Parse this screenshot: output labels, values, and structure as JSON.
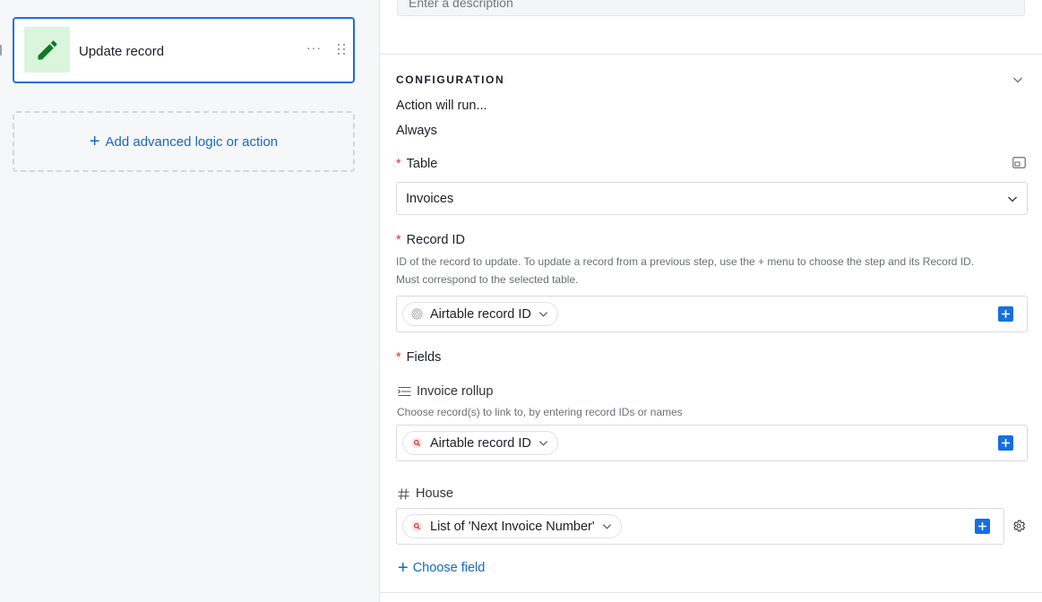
{
  "step_card": {
    "title": "Update record",
    "more_label": "···"
  },
  "add_logic": {
    "plus": "+",
    "label": "Add advanced logic or action"
  },
  "description": {
    "placeholder": "Enter a description"
  },
  "configuration": {
    "section_title": "CONFIGURATION",
    "action_runs_label": "Action will run...",
    "action_runs_value": "Always",
    "required_mark": "*",
    "table": {
      "label": "Table",
      "value": "Invoices"
    },
    "record_id": {
      "label": "Record ID",
      "help_line1": "ID of the record to update. To update a record from a previous step, use the + menu to choose the step and its Record ID.",
      "help_line2": "Must correspond to the selected table.",
      "token_label": "Airtable record ID"
    },
    "fields": {
      "label": "Fields",
      "items": [
        {
          "name": "Invoice rollup",
          "help": "Choose record(s) to link to, by entering record IDs or names",
          "token_label": "Airtable record ID"
        },
        {
          "name": "House",
          "token_label": "List of 'Next Invoice Number'"
        }
      ],
      "choose_field_plus": "+",
      "choose_field_label": "Choose field"
    }
  },
  "colors": {
    "accent": "#166ee1",
    "link": "#1668c9",
    "required": "#d4332f",
    "step_icon_bg": "#d9f5dc",
    "step_icon": "#0f7a23"
  }
}
